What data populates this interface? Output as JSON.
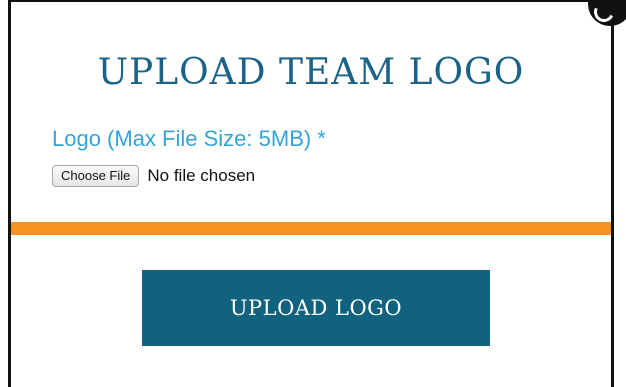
{
  "modal": {
    "title": "UPLOAD TEAM LOGO",
    "field_label": "Logo (Max File Size: 5MB) *",
    "file_input": {
      "button_label": "Choose File",
      "status_text": "No file chosen"
    },
    "submit_label": "UPLOAD LOGO",
    "close_icon": "close-icon"
  },
  "colors": {
    "title": "#1a6388",
    "label": "#34a4d8",
    "divider": "#f7931e",
    "submit_background": "#11627f",
    "border": "#111111"
  }
}
